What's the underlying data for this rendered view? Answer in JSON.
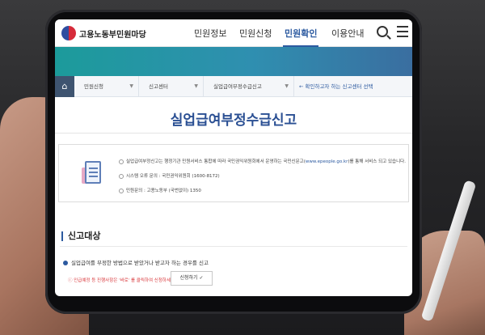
{
  "header": {
    "brand": "고용노동부민원마당",
    "nav": [
      "민원정보",
      "민원신청",
      "민원확인",
      "이용안내"
    ],
    "active_nav": "민원확인"
  },
  "breadcrumb": {
    "items": [
      "민원신청",
      "신고센터",
      "실업급여부정수급신고"
    ],
    "link": "← 확인하고자 하는 신고센터 선택"
  },
  "page": {
    "title": "실업급여부정수급신고"
  },
  "info": {
    "line1_prefix": "실업급여부정신고는 행정기관 민원서비스 통합에 따라 국민권익위원회에서 운영하는 국민신문고(",
    "line1_link": "www.epeople.go.kr",
    "line1_suffix": ")를 통해 서비스 되고 있습니다.",
    "line2": "시스템 오류 문의 : 국민권익위원회 (1600-8172)",
    "line3": "민원문의 : 고용노동부 (국번없이) 1350"
  },
  "section": {
    "title": "신고대상",
    "target": "실업급여를 부정한 방법으로 받았거나 받고자 하는 경우를 신고",
    "warning": "ⓘ 인급예정 등 진행사항은 '바로' 를 클릭하여 신청하세요.",
    "apply_button": "신청하기 ✓"
  },
  "colors": {
    "accent": "#2c5aa0",
    "hero_start": "#1c9b9b",
    "hero_end": "#3a6ea0",
    "warning": "#d9383c"
  }
}
